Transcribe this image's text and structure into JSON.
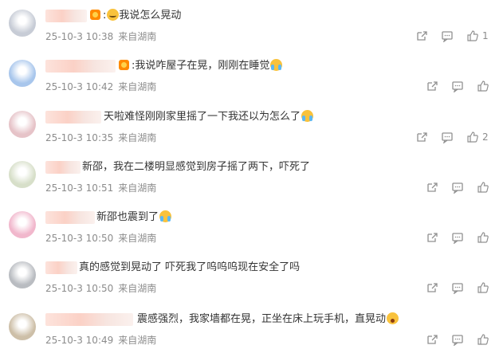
{
  "comments": [
    {
      "text": "我说怎么晃动",
      "prefix": ":",
      "has_badge": true,
      "emoji": "sweat-emoji",
      "date": "25-10-3",
      "time": "10:38",
      "location": "来自湖南",
      "likes": "1",
      "avatar_color": "#c7ccd6"
    },
    {
      "text": ":我说咋屋子在晃，刚刚在睡觉",
      "prefix": "",
      "has_badge": true,
      "emoji": "cry-emoji",
      "date": "25-10-3",
      "time": "10:42",
      "location": "来自湖南",
      "likes": "",
      "avatar_color": "#a8c6ec"
    },
    {
      "text": "天啦难怪刚刚家里摇了一下我还以为怎么了",
      "prefix": "",
      "has_badge": false,
      "emoji": "cry-emoji",
      "date": "25-10-3",
      "time": "10:35",
      "location": "来自湖南",
      "likes": "2",
      "avatar_color": "#e6c3c8"
    },
    {
      "text": "新邵，我在二楼明显感觉到房子摇了两下，吓死了",
      "prefix": "",
      "has_badge": false,
      "emoji": "",
      "date": "25-10-3",
      "time": "10:51",
      "location": "来自湖南",
      "likes": "",
      "avatar_color": "#d7dfc9"
    },
    {
      "text": "新邵也震到了",
      "prefix": "",
      "has_badge": false,
      "emoji": "cry-emoji",
      "date": "25-10-3",
      "time": "10:50",
      "location": "来自湖南",
      "likes": "",
      "avatar_color": "#f1b7cc"
    },
    {
      "text": "真的感觉到晃动了 吓死我了呜呜呜现在安全了吗",
      "prefix": "",
      "has_badge": false,
      "emoji": "",
      "date": "25-10-3",
      "time": "10:50",
      "location": "来自湖南",
      "likes": "",
      "avatar_color": "#b9bcc1"
    },
    {
      "text": "震感强烈，我家墙都在晃，正坐在床上玩手机，直晃动",
      "prefix": "",
      "has_badge": false,
      "emoji": "shock-emoji",
      "date": "25-10-3",
      "time": "10:49",
      "location": "来自湖南",
      "likes": "",
      "avatar_color": "#cdbfa8"
    }
  ],
  "icons": {
    "share": "share-icon",
    "comment": "comment-icon",
    "like": "thumbs-up-icon"
  },
  "colors": {
    "meta": "#8c8c8c",
    "icon": "#909090",
    "text": "#333333"
  }
}
